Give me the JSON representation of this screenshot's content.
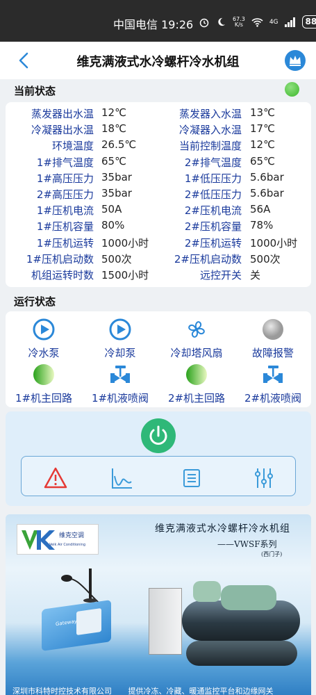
{
  "statusbar": {
    "carrier_time": "中国电信 19:26",
    "net_speed_value": "67.3",
    "net_speed_unit": "K/s",
    "network": "4G",
    "battery": "88"
  },
  "appbar": {
    "title": "维克满液式水冷螺杆冷水机组"
  },
  "current_status": {
    "label": "当前状态",
    "rows": [
      {
        "k1": "蒸发器出水温",
        "v1": "12℃",
        "k2": "蒸发器入水温",
        "v2": "13℃"
      },
      {
        "k1": "冷凝器出水温",
        "v1": "18℃",
        "k2": "冷凝器入水温",
        "v2": "17℃"
      },
      {
        "k1": "环境温度",
        "v1": "26.5℃",
        "k2": "当前控制温度",
        "v2": "12℃"
      },
      {
        "k1": "1#排气温度",
        "v1": "65℃",
        "k2": "2#排气温度",
        "v2": "65℃"
      },
      {
        "k1": "1#高压压力",
        "v1": "35bar",
        "k2": "1#低压压力",
        "v2": "5.6bar"
      },
      {
        "k1": "2#高压压力",
        "v1": "35bar",
        "k2": "2#低压压力",
        "v2": "5.6bar"
      },
      {
        "k1": "1#压机电流",
        "v1": "50A",
        "k2": "2#压机电流",
        "v2": "56A"
      },
      {
        "k1": "1#压机容量",
        "v1": "80%",
        "k2": "2#压机容量",
        "v2": "78%"
      },
      {
        "k1": "1#压机运转",
        "v1": "1000小时",
        "k2": "2#压机运转",
        "v2": "1000小时"
      },
      {
        "k1": "1#压机启动数",
        "v1": "500次",
        "k2": "2#压机启动数",
        "v2": "500次"
      },
      {
        "k1": "机组运转时数",
        "v1": "1500小时",
        "k2": "远控开关",
        "v2": "关"
      }
    ]
  },
  "operation_status": {
    "label": "运行状态",
    "items": [
      {
        "label": "冷水泵",
        "icon": "play-icon"
      },
      {
        "label": "冷却泵",
        "icon": "play-icon"
      },
      {
        "label": "冷却塔风扇",
        "icon": "fan-icon"
      },
      {
        "label": "故障报警",
        "icon": "alarm-indicator-icon"
      },
      {
        "label": "1#机主回路",
        "icon": "circuit-indicator-icon"
      },
      {
        "label": "1#机液喷阀",
        "icon": "valve-icon"
      },
      {
        "label": "2#机主回路",
        "icon": "circuit-indicator-icon"
      },
      {
        "label": "2#机液喷阀",
        "icon": "valve-icon"
      }
    ]
  },
  "controls": {
    "power_icon": "power-icon",
    "tools": [
      "warning-icon",
      "chart-icon",
      "list-icon",
      "settings-sliders-icon"
    ]
  },
  "banner": {
    "logo_cn": "维克空调",
    "logo_en": "Veik Air Conditioning",
    "device_label": "Gateway",
    "title": "维克满液式水冷螺杆冷水机组",
    "subtitle": "——VWSF系列",
    "subtitle2": "(西门子)",
    "footer_left": "深圳市科特时控技术有限公司",
    "footer_right": "提供冷冻、冷藏、暖通监控平台和边缘网关"
  },
  "colors": {
    "accent_blue": "#2b88d8",
    "label_blue": "#1a3a9c",
    "status_green": "#3db82c",
    "power_green": "#2fb878",
    "warning_red": "#e53935",
    "tool_blue": "#3a9ad9"
  }
}
